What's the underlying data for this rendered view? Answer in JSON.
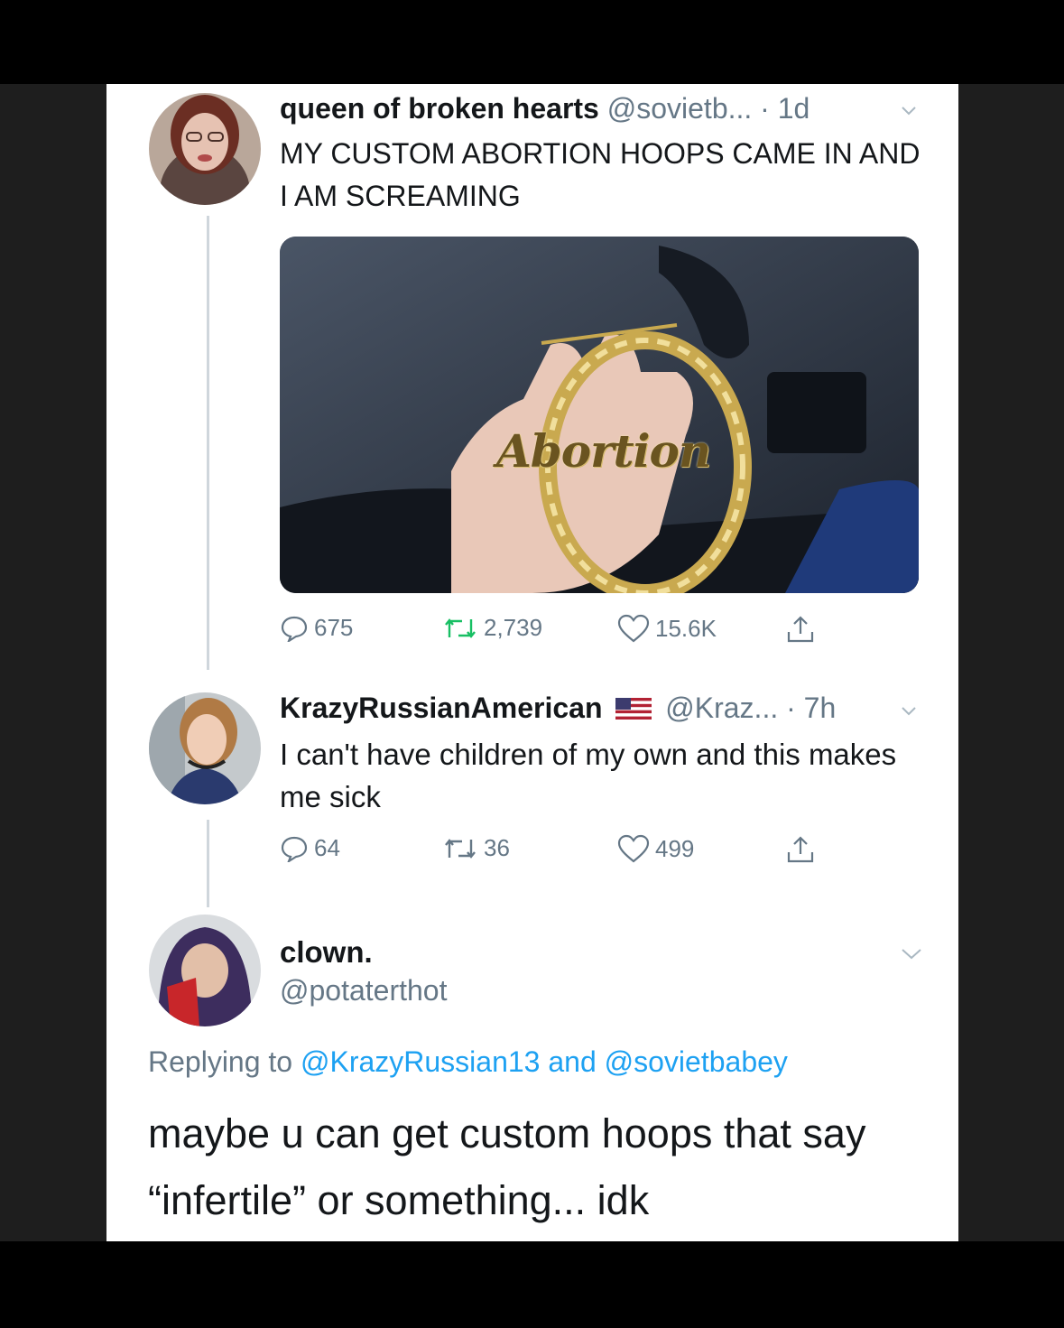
{
  "tweets": [
    {
      "display_name": "queen of broken hearts",
      "handle": "@sovietb...",
      "time": "· 1d",
      "text": "MY CUSTOM ABORTION HOOPS CAME IN AND I AM SCREAMING",
      "media_text": "Abortion",
      "stats": {
        "replies": "675",
        "retweets": "2,739",
        "likes": "15.6K"
      }
    },
    {
      "display_name": "KrazyRussianAmerican",
      "handle": "@Kraz...",
      "time": "· 7h",
      "text": "I can't have children of my own and this makes me sick",
      "stats": {
        "replies": "64",
        "retweets": "36",
        "likes": "499"
      }
    }
  ],
  "reply": {
    "display_name": "clown.",
    "handle": "@potaterthot",
    "replying_prefix": "Replying to",
    "mention1": "@KrazyRussian13",
    "and_word": "and",
    "mention2": "@sovietbabey",
    "text": "maybe u can get custom hoops that say “infertile” or something... idk"
  },
  "colors": {
    "text_primary": "#14171a",
    "text_secondary": "#657786",
    "link": "#1da1f2",
    "thread_line": "#cfd6dc"
  },
  "icons": [
    "reply-icon",
    "retweet-icon",
    "like-icon",
    "share-icon",
    "chevron-down-icon",
    "us-flag-icon"
  ]
}
